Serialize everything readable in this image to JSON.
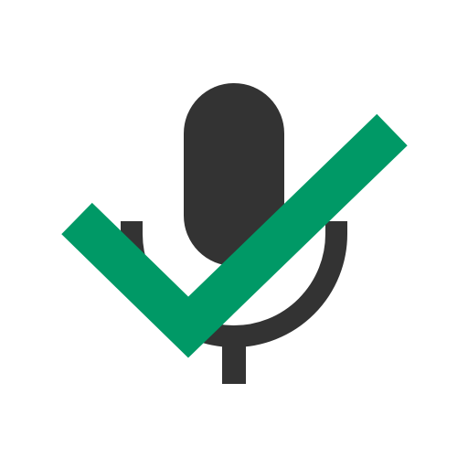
{
  "icon": {
    "name": "microphone-check-icon",
    "parts": {
      "microphone": "microphone-icon",
      "checkmark": "checkmark-icon"
    }
  },
  "colors": {
    "background": "#ffffff",
    "microphone": "#333333",
    "checkmark": "#009966"
  }
}
